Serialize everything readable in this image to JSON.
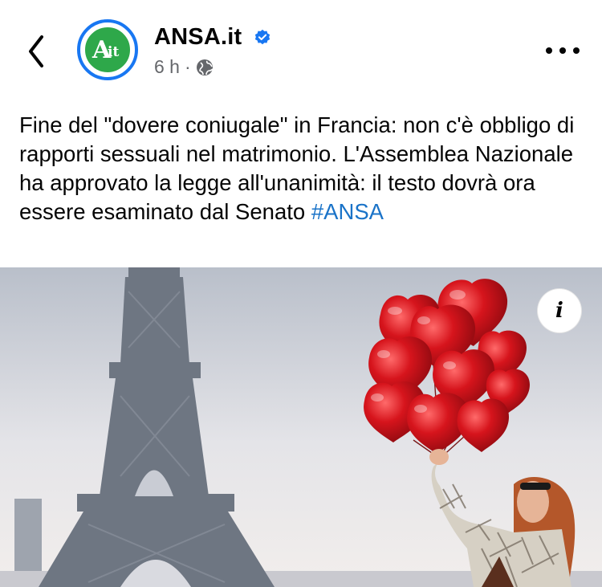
{
  "post": {
    "author": "ANSA.it",
    "time": "6 h",
    "separator": "·",
    "avatar_text": "Ait",
    "text": "Fine del \"dovere coniugale\" in Francia: non c'è obbligo di rapporti sessuali nel matrimonio. L'Assemblea Nazionale ha approvato la legge all'unanimità: il testo dovrà ora essere esaminato dal Senato ",
    "hashtag": "#ANSA"
  },
  "photo": {
    "info_label": "i"
  },
  "icons": {
    "back": "chevron-left-icon",
    "verified": "verified-badge-icon",
    "audience": "globe-icon",
    "more": "more-options-icon",
    "info": "info-icon"
  },
  "colors": {
    "accent_blue": "#1877f2",
    "hashtag": "#1a73c8",
    "avatar_green": "#2ea84a",
    "meta_gray": "#65676b",
    "balloon_red": "#c8121a"
  }
}
